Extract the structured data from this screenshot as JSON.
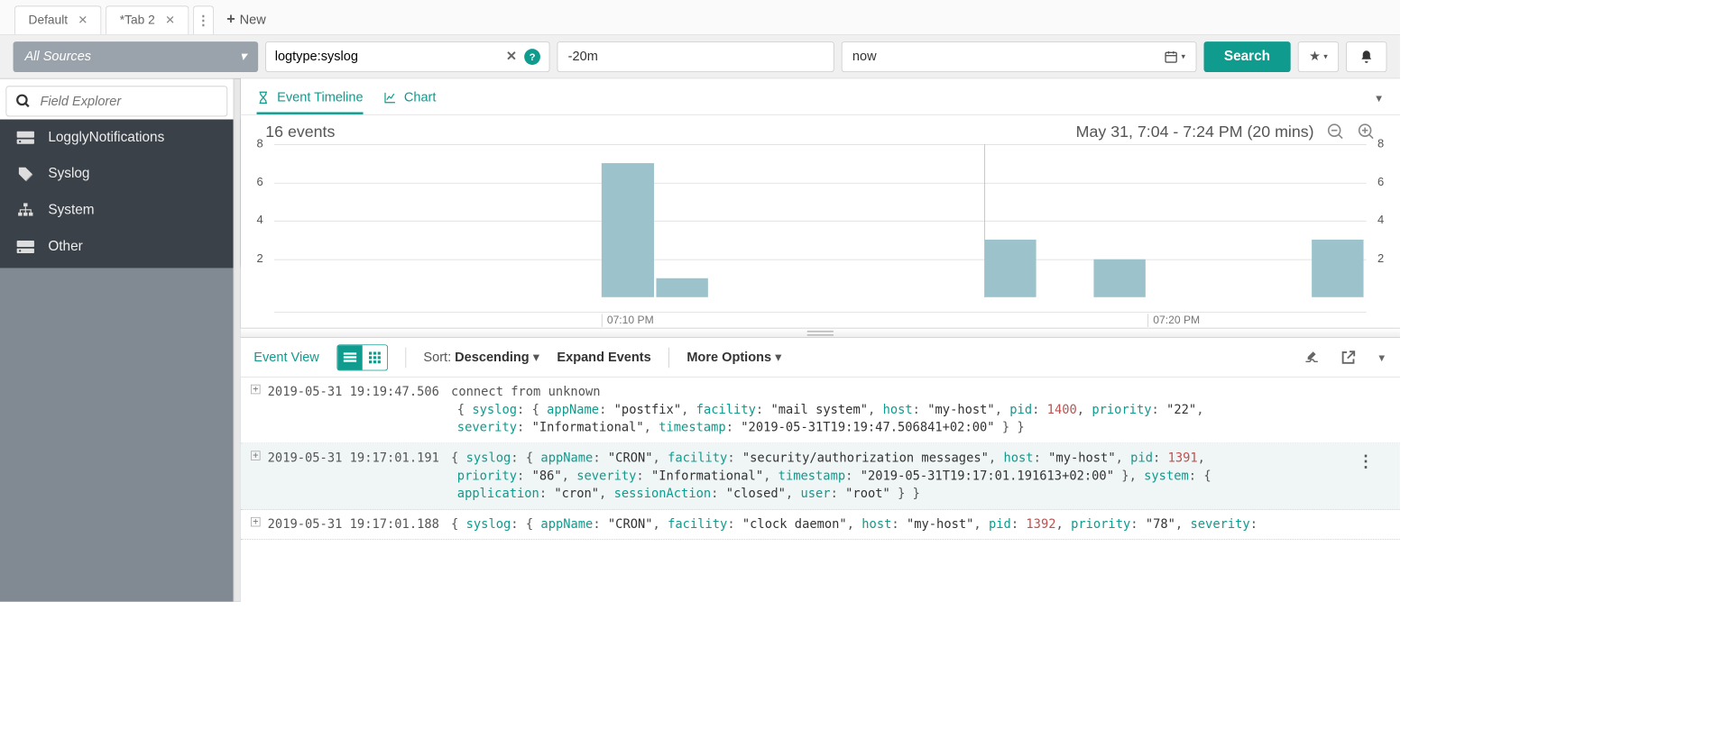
{
  "tabs": [
    {
      "label": "Default"
    },
    {
      "label": "*Tab 2",
      "active": true
    }
  ],
  "new_tab_label": "New",
  "sources_dropdown": "All Sources",
  "query": "logtype:syslog",
  "time_from": "-20m",
  "time_to": "now",
  "search_button": "Search",
  "field_explorer_placeholder": "Field Explorer",
  "sidebar_items": [
    {
      "label": "LogglyNotifications",
      "icon": "disk-icon"
    },
    {
      "label": "Syslog",
      "icon": "tag-icon"
    },
    {
      "label": "System",
      "icon": "sitemap-icon"
    },
    {
      "label": "Other",
      "icon": "disk-icon"
    }
  ],
  "view_tabs": {
    "timeline": "Event Timeline",
    "chart": "Chart"
  },
  "event_count": "16 events",
  "time_range": "May 31, 7:04 - 7:24 PM  (20 mins)",
  "chart_data": {
    "type": "bar",
    "x_ticks": [
      "07:10 PM",
      "07:20 PM"
    ],
    "y_ticks": [
      2,
      4,
      6,
      8
    ],
    "ylim": [
      0,
      8
    ],
    "categories_minutes": [
      "07:04",
      "07:05",
      "07:06",
      "07:07",
      "07:08",
      "07:09",
      "07:10",
      "07:11",
      "07:12",
      "07:13",
      "07:14",
      "07:15",
      "07:16",
      "07:17",
      "07:18",
      "07:19",
      "07:20",
      "07:21",
      "07:22",
      "07:23"
    ],
    "values": [
      0,
      0,
      0,
      0,
      0,
      0,
      7,
      1,
      0,
      0,
      0,
      0,
      0,
      3,
      0,
      2,
      0,
      0,
      0,
      3
    ]
  },
  "event_view": {
    "label": "Event View",
    "sort_prefix": "Sort:",
    "sort_value": "Descending",
    "expand": "Expand Events",
    "more": "More Options"
  },
  "log_entries": [
    {
      "ts": "2019-05-31 19:19:47.506",
      "msg": "connect from unknown",
      "json_line1": "{ syslog: { appName: \"postfix\", facility: \"mail system\", host: \"my-host\", pid: 1400, priority: \"22\",",
      "json_line2": "severity: \"Informational\", timestamp: \"2019-05-31T19:19:47.506841+02:00\" } }"
    },
    {
      "ts": "2019-05-31 19:17:01.191",
      "json_line0": "{ syslog: { appName: \"CRON\", facility: \"security/authorization messages\", host: \"my-host\", pid: 1391,",
      "json_line1": "priority: \"86\", severity: \"Informational\", timestamp: \"2019-05-31T19:17:01.191613+02:00\" }, system: {",
      "json_line2": "application: \"cron\", sessionAction: \"closed\", user: \"root\" } }",
      "has_more": true,
      "alt": true
    },
    {
      "ts": "2019-05-31 19:17:01.188",
      "json_line0": "{ syslog: { appName: \"CRON\", facility: \"clock daemon\", host: \"my-host\", pid: 1392, priority: \"78\", severity:"
    }
  ]
}
